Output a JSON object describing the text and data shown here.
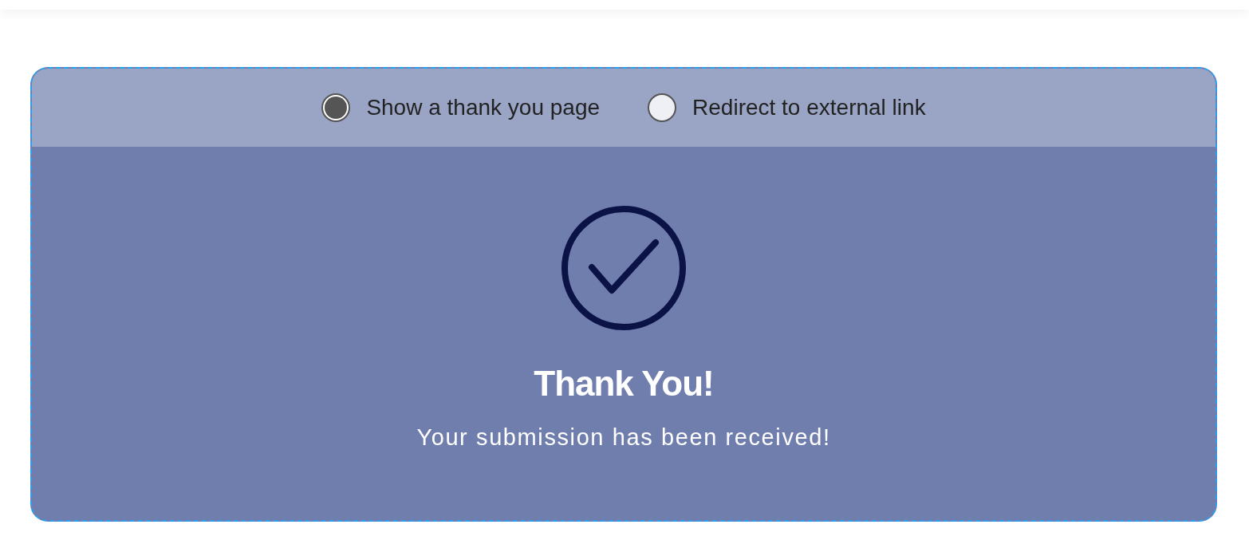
{
  "options": [
    {
      "label": "Show a thank you page",
      "selected": true
    },
    {
      "label": "Redirect to external link",
      "selected": false
    }
  ],
  "thank_you": {
    "title": "Thank You!",
    "message": "Your submission has been received!"
  }
}
